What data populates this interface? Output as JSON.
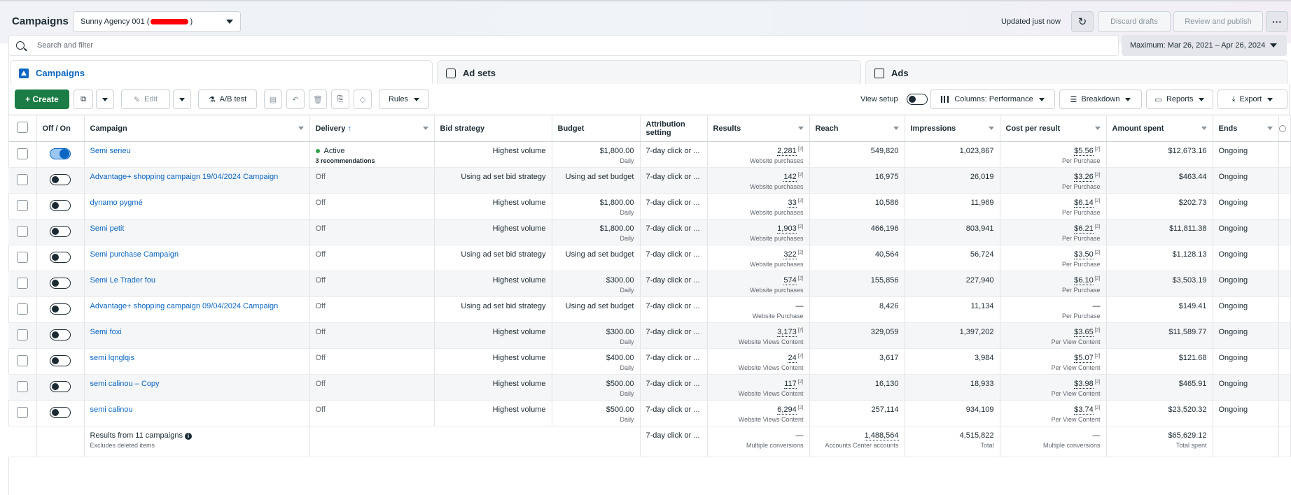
{
  "header": {
    "title": "Campaigns",
    "account_prefix": "Sunny Agency 001 (",
    "account_suffix": ")",
    "updated": "Updated just now",
    "discard_label": "Discard drafts",
    "review_label": "Review and publish",
    "more_label": "···"
  },
  "search": {
    "placeholder": "Search and filter"
  },
  "date_range": "Maximum: Mar 26, 2021 – Apr 26, 2024",
  "tabs": [
    {
      "label": "Campaigns",
      "icon": "campaign-icon",
      "active": true
    },
    {
      "label": "Ad sets",
      "icon": "adsets-icon",
      "active": false
    },
    {
      "label": "Ads",
      "icon": "ads-icon",
      "active": false
    }
  ],
  "toolbar": {
    "create_label": "+  Create",
    "edit_label": "Edit",
    "abtest_label": "A/B test",
    "rules_label": "Rules",
    "view_setup_label": "View setup",
    "columns_label": "Columns: Performance",
    "breakdown_label": "Breakdown",
    "reports_label": "Reports",
    "export_label": "Export"
  },
  "columns": {
    "offon": "Off / On",
    "campaign": "Campaign",
    "delivery": "Delivery",
    "bid": "Bid strategy",
    "budget": "Budget",
    "attribution": "Attribution setting",
    "results": "Results",
    "reach": "Reach",
    "impressions": "Impressions",
    "cpr": "Cost per result",
    "amount": "Amount spent",
    "ends": "Ends"
  },
  "rows": [
    {
      "name": "Semi serieu",
      "on": true,
      "delivery": "Active",
      "rec": "3 recommendations",
      "bid": "Highest volume",
      "budget": "$1,800.00",
      "budget_sub": "Daily",
      "attr": "7-day click or ...",
      "results": "2,281",
      "results_fn": "[2]",
      "results_sub": "Website purchases",
      "reach": "549,820",
      "impressions": "1,023,867",
      "cpr": "$5.56",
      "cpr_fn": "[2]",
      "cpr_sub": "Per Purchase",
      "amount": "$12,673.16",
      "ends": "Ongoing"
    },
    {
      "name": "Advantage+ shopping campaign 19/04/2024 Campaign",
      "on": false,
      "delivery": "Off",
      "rec": "",
      "bid": "Using ad set bid strategy",
      "budget": "Using ad set budget",
      "budget_sub": "",
      "attr": "7-day click or ...",
      "results": "142",
      "results_fn": "[2]",
      "results_sub": "Website purchases",
      "reach": "16,975",
      "impressions": "26,019",
      "cpr": "$3.26",
      "cpr_fn": "[2]",
      "cpr_sub": "Per Purchase",
      "amount": "$463.44",
      "ends": "Ongoing"
    },
    {
      "name": "dynamo pygmé",
      "on": false,
      "delivery": "Off",
      "rec": "",
      "bid": "Highest volume",
      "budget": "$1,800.00",
      "budget_sub": "Daily",
      "attr": "7-day click or ...",
      "results": "33",
      "results_fn": "[2]",
      "results_sub": "Website purchases",
      "reach": "10,586",
      "impressions": "11,969",
      "cpr": "$6.14",
      "cpr_fn": "[2]",
      "cpr_sub": "Per Purchase",
      "amount": "$202.73",
      "ends": "Ongoing"
    },
    {
      "name": "Semi petit",
      "on": false,
      "delivery": "Off",
      "rec": "",
      "bid": "Highest volume",
      "budget": "$1,800.00",
      "budget_sub": "Daily",
      "attr": "7-day click or ...",
      "results": "1,903",
      "results_fn": "[2]",
      "results_sub": "Website purchases",
      "reach": "466,196",
      "impressions": "803,941",
      "cpr": "$6.21",
      "cpr_fn": "[2]",
      "cpr_sub": "Per Purchase",
      "amount": "$11,811.38",
      "ends": "Ongoing"
    },
    {
      "name": "Semi purchase Campaign",
      "on": false,
      "delivery": "Off",
      "rec": "",
      "bid": "Using ad set bid strategy",
      "budget": "Using ad set budget",
      "budget_sub": "",
      "attr": "7-day click or ...",
      "results": "322",
      "results_fn": "[2]",
      "results_sub": "Website purchases",
      "reach": "40,564",
      "impressions": "56,724",
      "cpr": "$3.50",
      "cpr_fn": "[2]",
      "cpr_sub": "Per Purchase",
      "amount": "$1,128.13",
      "ends": "Ongoing"
    },
    {
      "name": "Semi Le Trader fou",
      "on": false,
      "delivery": "Off",
      "rec": "",
      "bid": "Highest volume",
      "budget": "$300.00",
      "budget_sub": "Daily",
      "attr": "7-day click or ...",
      "results": "574",
      "results_fn": "[2]",
      "results_sub": "Website purchases",
      "reach": "155,856",
      "impressions": "227,940",
      "cpr": "$6.10",
      "cpr_fn": "[2]",
      "cpr_sub": "Per Purchase",
      "amount": "$3,503.19",
      "ends": "Ongoing"
    },
    {
      "name": "Advantage+ shopping campaign 09/04/2024 Campaign",
      "on": false,
      "delivery": "Off",
      "rec": "",
      "bid": "Using ad set bid strategy",
      "budget": "Using ad set budget",
      "budget_sub": "",
      "attr": "7-day click or ...",
      "results": "—",
      "results_fn": "",
      "results_sub": "Website Purchase",
      "reach": "8,426",
      "impressions": "11,134",
      "cpr": "—",
      "cpr_fn": "",
      "cpr_sub": "Per Purchase",
      "amount": "$149.41",
      "ends": "Ongoing"
    },
    {
      "name": "Semi foxi",
      "on": false,
      "delivery": "Off",
      "rec": "",
      "bid": "Highest volume",
      "budget": "$300.00",
      "budget_sub": "Daily",
      "attr": "7-day click or ...",
      "results": "3,173",
      "results_fn": "[2]",
      "results_sub": "Website Views Content",
      "reach": "329,059",
      "impressions": "1,397,202",
      "cpr": "$3.65",
      "cpr_fn": "[2]",
      "cpr_sub": "Per View Content",
      "amount": "$11,589.77",
      "ends": "Ongoing"
    },
    {
      "name": "semi lqnglqis",
      "on": false,
      "delivery": "Off",
      "rec": "",
      "bid": "Highest volume",
      "budget": "$400.00",
      "budget_sub": "Daily",
      "attr": "7-day click or ...",
      "results": "24",
      "results_fn": "[2]",
      "results_sub": "Website Views Content",
      "reach": "3,617",
      "impressions": "3,984",
      "cpr": "$5.07",
      "cpr_fn": "[2]",
      "cpr_sub": "Per View Content",
      "amount": "$121.68",
      "ends": "Ongoing"
    },
    {
      "name": "semi calinou – Copy",
      "on": false,
      "delivery": "Off",
      "rec": "",
      "bid": "Highest volume",
      "budget": "$500.00",
      "budget_sub": "Daily",
      "attr": "7-day click or ...",
      "results": "117",
      "results_fn": "[2]",
      "results_sub": "Website Views Content",
      "reach": "16,130",
      "impressions": "18,933",
      "cpr": "$3.98",
      "cpr_fn": "[2]",
      "cpr_sub": "Per View Content",
      "amount": "$465.91",
      "ends": "Ongoing"
    },
    {
      "name": "semi calinou",
      "on": false,
      "delivery": "Off",
      "rec": "",
      "bid": "Highest volume",
      "budget": "$500.00",
      "budget_sub": "Daily",
      "attr": "7-day click or ...",
      "results": "6,294",
      "results_fn": "[2]",
      "results_sub": "Website Views Content",
      "reach": "257,114",
      "impressions": "934,109",
      "cpr": "$3.74",
      "cpr_fn": "[2]",
      "cpr_sub": "Per View Content",
      "amount": "$23,520.32",
      "ends": "Ongoing"
    }
  ],
  "footer": {
    "label": "Results from 11 campaigns",
    "sub": "Excludes deleted items",
    "attr": "7-day click or ...",
    "results": "—",
    "results_sub": "Multiple conversions",
    "reach": "1,488,564",
    "reach_sub": "Accounts Center accounts",
    "impressions": "4,515,822",
    "impressions_sub": "Total",
    "cpr": "—",
    "cpr_sub": "Multiple conversions",
    "amount": "$65,629.12",
    "amount_sub": "Total spent"
  },
  "colors": {
    "accent": "#0a66c2",
    "create": "#1c7c45",
    "active_dot": "#31a24c",
    "redaction": "#ff0000"
  }
}
